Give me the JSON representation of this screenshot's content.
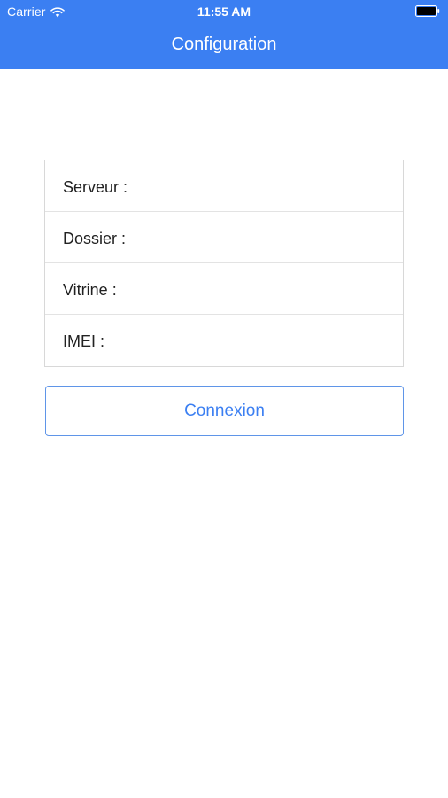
{
  "status_bar": {
    "carrier": "Carrier",
    "time": "11:55 AM",
    "wifi_icon": "wifi-icon",
    "battery_icon": "battery-icon"
  },
  "nav": {
    "title": "Configuration",
    "background_color": "#3b7ff2"
  },
  "form": {
    "fields": [
      {
        "label": "Serveur :",
        "value": ""
      },
      {
        "label": "Dossier :",
        "value": ""
      },
      {
        "label": "Vitrine :",
        "value": ""
      },
      {
        "label": "IMEI :",
        "value": ""
      }
    ]
  },
  "actions": {
    "connect_label": "Connexion",
    "accent_color": "#3b7ff2"
  }
}
